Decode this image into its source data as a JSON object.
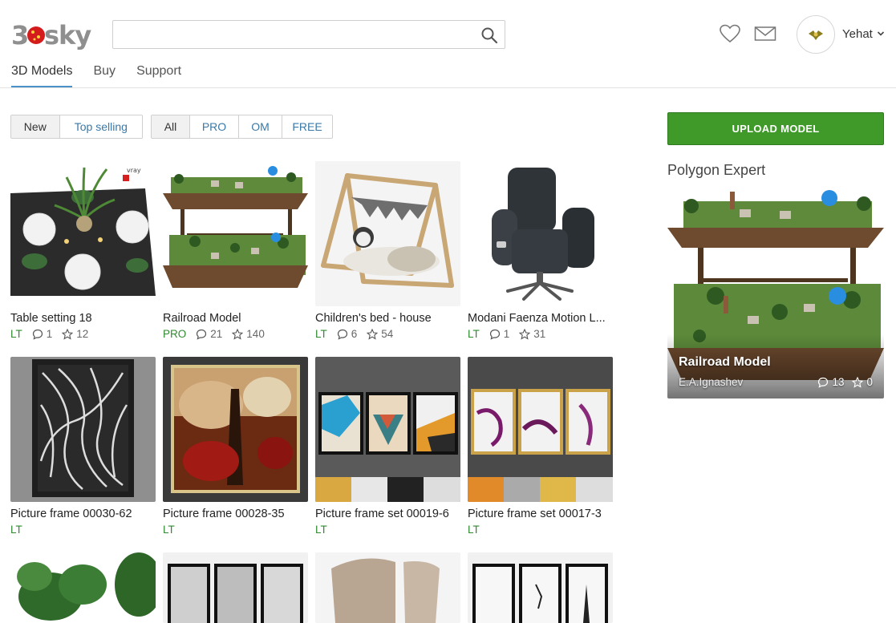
{
  "header": {
    "logo_text": "3dsky",
    "search_placeholder": "",
    "username": "Yehat"
  },
  "nav": {
    "tabs": [
      {
        "label": "3D Models",
        "active": true
      },
      {
        "label": "Buy",
        "active": false
      },
      {
        "label": "Support",
        "active": false
      }
    ]
  },
  "filters": {
    "sort": [
      {
        "label": "New",
        "active": true
      },
      {
        "label": "Top selling",
        "active": false
      }
    ],
    "type": [
      {
        "label": "All",
        "active": true
      },
      {
        "label": "PRO",
        "active": false
      },
      {
        "label": "OM",
        "active": false
      },
      {
        "label": "FREE",
        "active": false
      }
    ]
  },
  "models": [
    {
      "title": "Table setting 18",
      "license": "LT",
      "comments": "1",
      "rating": "12",
      "icon": "table-setting-image"
    },
    {
      "title": "Railroad Model",
      "license": "PRO",
      "comments": "21",
      "rating": "140",
      "icon": "railroad-image"
    },
    {
      "title": "Children's bed - house",
      "license": "LT",
      "comments": "6",
      "rating": "54",
      "icon": "bed-image"
    },
    {
      "title": "Modani Faenza Motion L...",
      "license": "LT",
      "comments": "1",
      "rating": "31",
      "icon": "armchair-image"
    },
    {
      "title": "Picture frame 00030-62",
      "license": "LT",
      "icon": "picture-frame-image"
    },
    {
      "title": "Picture frame 00028-35",
      "license": "LT",
      "icon": "picture-frame-image"
    },
    {
      "title": "Picture frame set 00019-6",
      "license": "LT",
      "icon": "picture-frame-set-image"
    },
    {
      "title": "Picture frame set 00017-3",
      "license": "LT",
      "icon": "picture-frame-set-image"
    },
    {
      "title": "",
      "icon": "plant-image"
    },
    {
      "title": "",
      "icon": "picture-frame-set-image"
    },
    {
      "title": "",
      "icon": "chair-image"
    },
    {
      "title": "",
      "icon": "picture-frame-set-image"
    }
  ],
  "sidebar": {
    "upload_label": "UPLOAD MODEL",
    "panel_title": "Polygon Expert",
    "featured": {
      "title": "Railroad Model",
      "author": "E.A.Ignashev",
      "comments": "13",
      "rating": "0"
    }
  },
  "colors": {
    "accent_green": "#3f9a2a",
    "license_green": "#2e8b2e",
    "link_blue": "#3a79a8",
    "active_tab_underline": "#4a90c9"
  }
}
